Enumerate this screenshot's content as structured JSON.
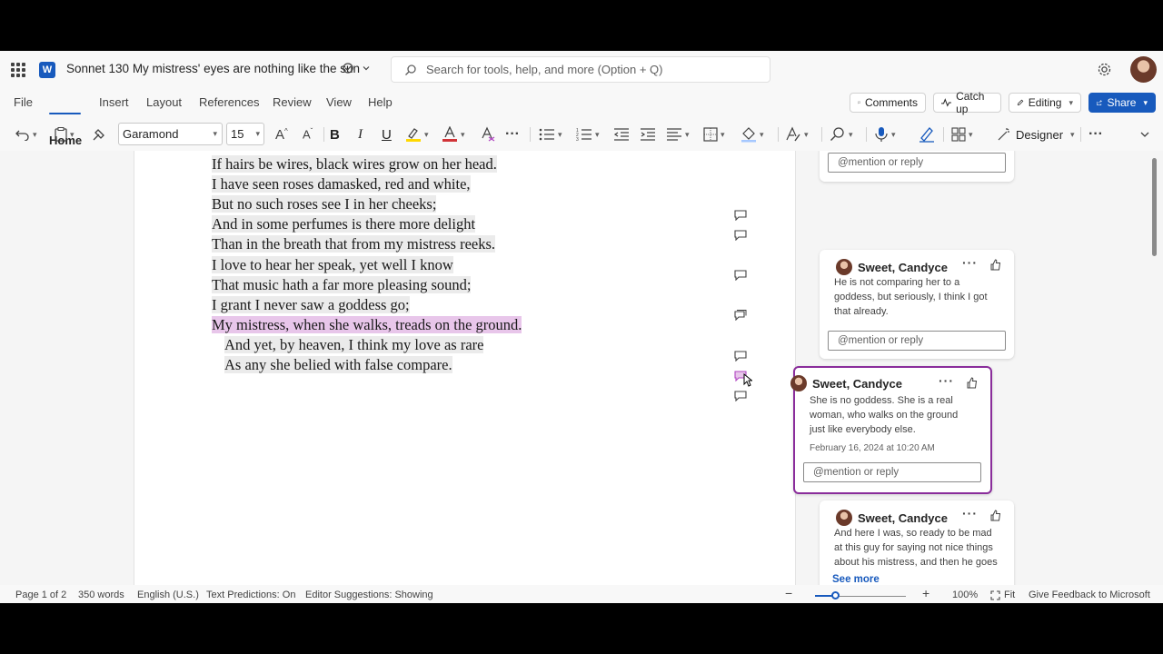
{
  "app": {
    "title": "Sonnet 130 My mistress' eyes are nothing like the sun",
    "logo_letter": "W",
    "search_placeholder": "Search for tools, help, and more (Option + Q)"
  },
  "menu": {
    "items": [
      "File",
      "Home",
      "Insert",
      "Layout",
      "References",
      "Review",
      "View",
      "Help"
    ],
    "active": "Home",
    "comments_label": "Comments",
    "catchup_label": "Catch up",
    "editing_label": "Editing",
    "share_label": "Share"
  },
  "ribbon": {
    "font_name": "Garamond",
    "font_size": "15",
    "designer_label": "Designer"
  },
  "document": {
    "lines": [
      {
        "text": "If hairs be wires, black wires grow on her head.",
        "indent": false,
        "active": false
      },
      {
        "text": "I have seen roses damasked, red and white,",
        "indent": false,
        "active": false
      },
      {
        "text": "But no such roses see I in her cheeks;",
        "indent": false,
        "active": false
      },
      {
        "text": "And in some perfumes is there more delight",
        "indent": false,
        "active": false
      },
      {
        "text": "Than in the breath that from my mistress reeks.",
        "indent": false,
        "active": false
      },
      {
        "text": "I love to hear her speak, yet well I know",
        "indent": false,
        "active": false
      },
      {
        "text": "That music hath a far more pleasing sound;",
        "indent": false,
        "active": false
      },
      {
        "text": "I grant I never saw a goddess go;",
        "indent": false,
        "active": false
      },
      {
        "text": "My mistress, when she walks, treads on the ground.",
        "indent": false,
        "active": true
      },
      {
        "text": "And yet, by heaven, I think my love as rare",
        "indent": true,
        "active": false
      },
      {
        "text": "As any she belied with false compare.",
        "indent": true,
        "active": false
      }
    ]
  },
  "comments": {
    "reply_placeholder": "@mention or reply",
    "cards": [
      {
        "author": "Sweet, Candyce",
        "body": "He is not comparing her to a goddess, but seriously, I think I got that already.",
        "date": "",
        "see_more": ""
      },
      {
        "author": "Sweet, Candyce",
        "body": "She is no goddess. She is a real woman, who walks on the ground just like everybody else.",
        "date": "February 16, 2024 at 10:20 AM",
        "see_more": ""
      },
      {
        "author": "Sweet, Candyce",
        "body": "And here I was, so ready to be mad at this guy for saying not nice things about his mistress, and then he goes",
        "date": "",
        "see_more": "See more"
      }
    ]
  },
  "status": {
    "page": "Page 1 of 2",
    "words": "350 words",
    "language": "English (U.S.)",
    "predictions": "Text Predictions: On",
    "suggestions": "Editor Suggestions: Showing",
    "zoom": "100%",
    "zoom_fraction": 0.22,
    "fit": "Fit",
    "feedback": "Give Feedback to Microsoft"
  },
  "colors": {
    "accent": "#185abd",
    "active_comment": "#8a2d9b",
    "highlight": "#ebebeb",
    "active_highlight": "#e8c6ea"
  }
}
